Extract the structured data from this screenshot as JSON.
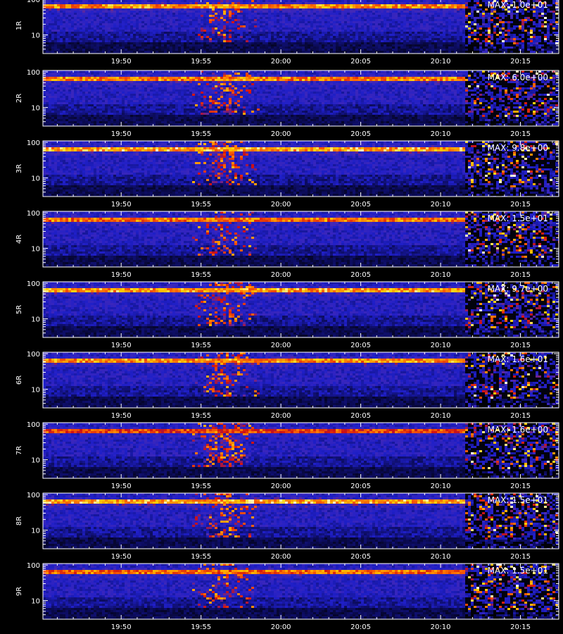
{
  "chart_data": {
    "type": "heatmap",
    "colormap": [
      "#000000",
      "#0a0a52",
      "#1f1fc8",
      "#4a2ab4",
      "#d01010",
      "#ff6a00",
      "#ffd000",
      "#ffffff"
    ],
    "x_tick_labels": [
      "19:50",
      "19:55",
      "20:00",
      "20:05",
      "20:10",
      "20:15"
    ],
    "x_ticks_minutes": [
      0,
      5,
      10,
      15,
      20,
      25
    ],
    "x_range_minutes": [
      -4.9,
      27.4
    ],
    "data_gap_start_minutes": 21.5,
    "y_scale": "log",
    "y_range": [
      3,
      110
    ],
    "y_tick_labels": [
      "100",
      "10"
    ],
    "x_title": "",
    "panels": [
      {
        "label": "1R",
        "max_label": "MAX: 1.0e+01",
        "band_intensity": 0.85,
        "burst_intensity": 0.55
      },
      {
        "label": "2R",
        "max_label": "MAX: 6.0e+00",
        "band_intensity": 0.8,
        "burst_intensity": 0.75
      },
      {
        "label": "3R",
        "max_label": "MAX: 9.8e+00",
        "band_intensity": 0.95,
        "burst_intensity": 0.8
      },
      {
        "label": "4R",
        "max_label": "MAX: 1.5e+01",
        "band_intensity": 0.75,
        "burst_intensity": 0.5
      },
      {
        "label": "5R",
        "max_label": "MAX: 9.7e+00",
        "band_intensity": 0.9,
        "burst_intensity": 0.75
      },
      {
        "label": "6R",
        "max_label": "MAX: 1.6e+01",
        "band_intensity": 0.85,
        "burst_intensity": 0.6
      },
      {
        "label": "7R",
        "max_label": "MAX: 1.6e+00",
        "band_intensity": 0.55,
        "burst_intensity": 0.95
      },
      {
        "label": "8R",
        "max_label": "MAX: 1.5e+01",
        "band_intensity": 0.95,
        "burst_intensity": 0.55
      },
      {
        "label": "9R",
        "max_label": "MAX: 1.5e+01",
        "band_intensity": 0.7,
        "burst_intensity": 0.5
      }
    ]
  }
}
